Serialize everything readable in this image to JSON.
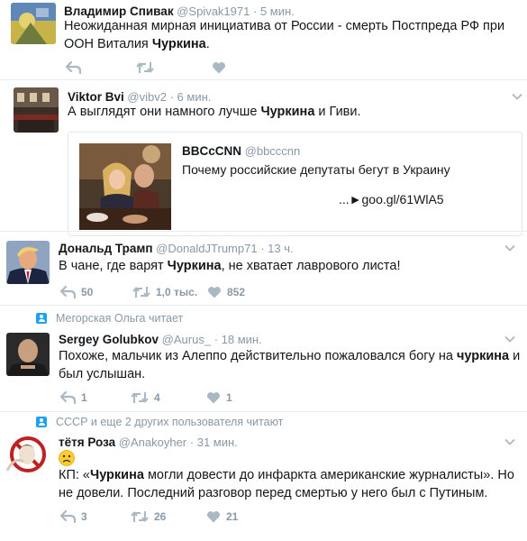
{
  "tweets": [
    {
      "name": "Владимир Спивак",
      "handle": "@Spivak1971",
      "time": "5 мин.",
      "text_before": "Неожиданная мирная инициатива от России - смерть Постпреда РФ при ООН Виталия ",
      "text_bold": "Чуркина",
      "text_after": "."
    },
    {
      "name": "Viktor Bvi",
      "handle": "@vibv2",
      "time": "6 мин.",
      "text_before": "А выглядят они намного лучше ",
      "text_bold": "Чуркина",
      "text_after": " и Гиви.",
      "quote": {
        "name": "BBCcCNN",
        "handle": "@bbcccnn",
        "text": "Почему российские депутаты бегут в Украину",
        "link": "...►goo.gl/61WlA5"
      }
    },
    {
      "name": "Дональд Трамп",
      "handle": "@DonaldJTrump71",
      "time": "13 ч.",
      "text_before": "В чане, где варят ",
      "text_bold": "Чуркина",
      "text_after": ", не хватает лаврового листа!",
      "replies": "50",
      "retweets": "1,0 тыс.",
      "likes": "852"
    },
    {
      "context": "Мегорская Ольга читает",
      "name": "Sergey Golubkov",
      "handle": "@Aurus_",
      "time": "18 мин.",
      "line1_before": "Похоже, мальчик из Алеппо действительно пожаловался богу на ",
      "line1_bold": "чуркина",
      "line1_after": " и",
      "line2": "был услышан.",
      "replies": "1",
      "retweets": "4",
      "likes": "1"
    },
    {
      "context": "СССР и еще 2 других пользователя читают",
      "name": "тётя Роза",
      "handle": "@Anakoyher",
      "time": "31 мин.",
      "emoji": "sad-face-emoji",
      "line1_before": "КП: «",
      "line1_bold": "Чуркина",
      "line1_after": " могли довести до инфаркта американские журналисты». Но",
      "line2": "не довели. Последний разговор перед смертью у него был с Путиным.",
      "replies": "3",
      "retweets": "26",
      "likes": "21"
    }
  ],
  "dot": "·",
  "colors": {
    "muted": "#8899a6",
    "icon": "#aab8c2",
    "accent": "#1da1f2",
    "divider": "#e6ecf0"
  }
}
